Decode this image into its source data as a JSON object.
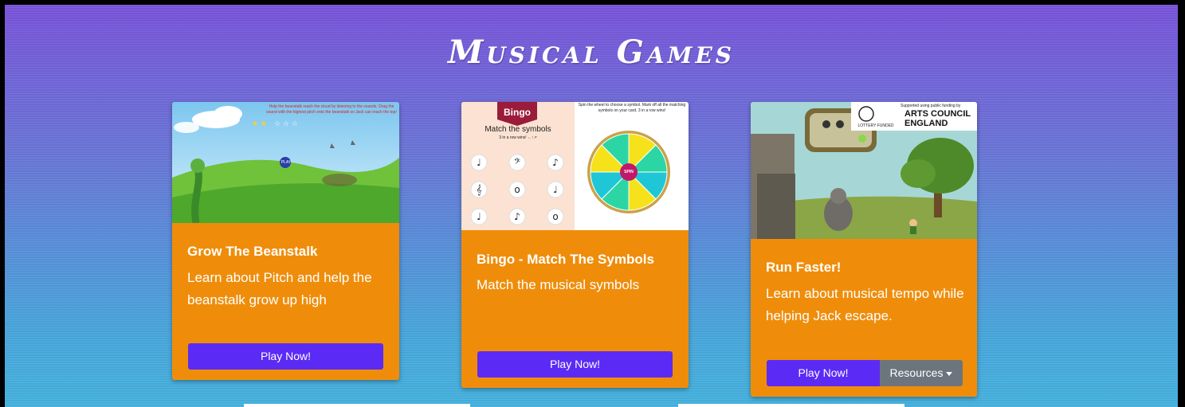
{
  "page": {
    "title": "Musical Games"
  },
  "cards": [
    {
      "title": "Grow The Beanstalk",
      "text": "Learn about Pitch and help the beanstalk grow up high",
      "button": "Play Now!",
      "thumb_caption": "Help the beanstalk reach the cloud by listening to the sounds. Drag the sound with the highest pitch onto the beanstalk so Jack can reach the top!",
      "thumb_play": "PLAY"
    },
    {
      "title": "Bingo - Match The Symbols",
      "text": "Match the musical symbols",
      "button": "Play Now!",
      "thumb_badge": "Bingo",
      "thumb_heading": "Match the symbols",
      "thumb_sub": "3 in a row wins! ←↑↗",
      "thumb_instructions": "Spin the wheel to choose a symbol. Mark off all the matching symbols on your card. 3 in a row wins!",
      "thumb_spin": "SPIN"
    },
    {
      "title": "Run Faster!",
      "text": "Learn about musical tempo while helping Jack escape.",
      "button": "Play Now!",
      "resources": "Resources",
      "thumb_support": "Supported using public funding by",
      "thumb_arts": "ARTS COUNCIL",
      "thumb_england": "ENGLAND",
      "thumb_lottery": "LOTTERY FUNDED"
    }
  ],
  "colors": {
    "card": "#ef8d0b",
    "button": "#5b2bf5",
    "resources": "#6c757d"
  }
}
